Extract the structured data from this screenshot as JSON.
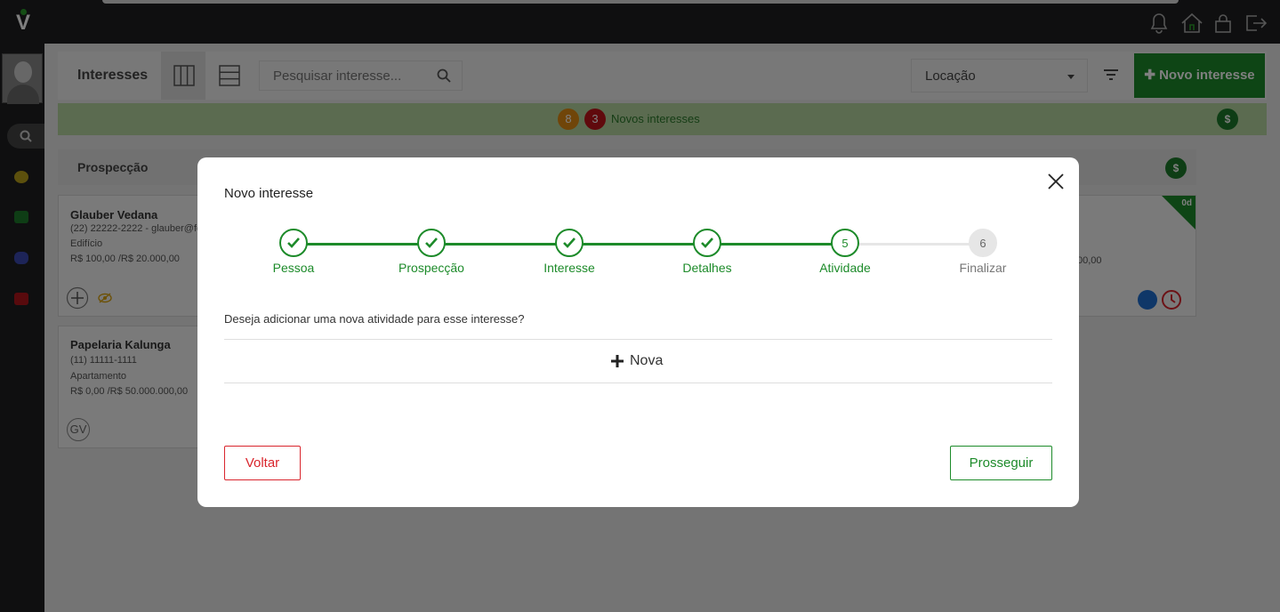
{
  "app": {
    "logo": "V",
    "colors": {
      "accent": "#1d8b2a",
      "danger": "#d9252d",
      "warning": "#e08a12",
      "banner": "#b7d6a0"
    }
  },
  "topbar": {
    "icons": [
      "bell-icon",
      "home-icon",
      "lock-icon",
      "logout-icon"
    ]
  },
  "header": {
    "title": "Interesses",
    "search_placeholder": "Pesquisar interesse...",
    "select_value": "Locação",
    "new_button": "Novo interesse"
  },
  "banner": {
    "count_orange": "8",
    "count_red": "3",
    "text": "Novos interesses",
    "currency": "$"
  },
  "column": {
    "title": "Prospecção",
    "currency": "$"
  },
  "cards": [
    {
      "name": "Glauber Vedana",
      "contact": "(22) 22222-2222 - glauber@fe",
      "type": "Edifício",
      "value": "R$ 100,00 /R$ 20.000,00"
    },
    {
      "name": "Papelaria Kalunga",
      "contact": "(11) 11111-1111",
      "type": "Apartamento",
      "value": "R$ 0,00 /R$ 50.000.000,00",
      "initials": "GV"
    }
  ],
  "right_card": {
    "age": "0d",
    "value": "00,00"
  },
  "modal": {
    "title": "Novo interesse",
    "steps": [
      {
        "label": "Pessoa",
        "state": "done"
      },
      {
        "label": "Prospecção",
        "state": "done"
      },
      {
        "label": "Interesse",
        "state": "done"
      },
      {
        "label": "Detalhes",
        "state": "done"
      },
      {
        "label": "Atividade",
        "state": "current",
        "number": "5"
      },
      {
        "label": "Finalizar",
        "state": "todo",
        "number": "6"
      }
    ],
    "question": "Deseja adicionar uma nova atividade para esse interesse?",
    "new_label": "Nova",
    "back_label": "Voltar",
    "next_label": "Prosseguir"
  }
}
